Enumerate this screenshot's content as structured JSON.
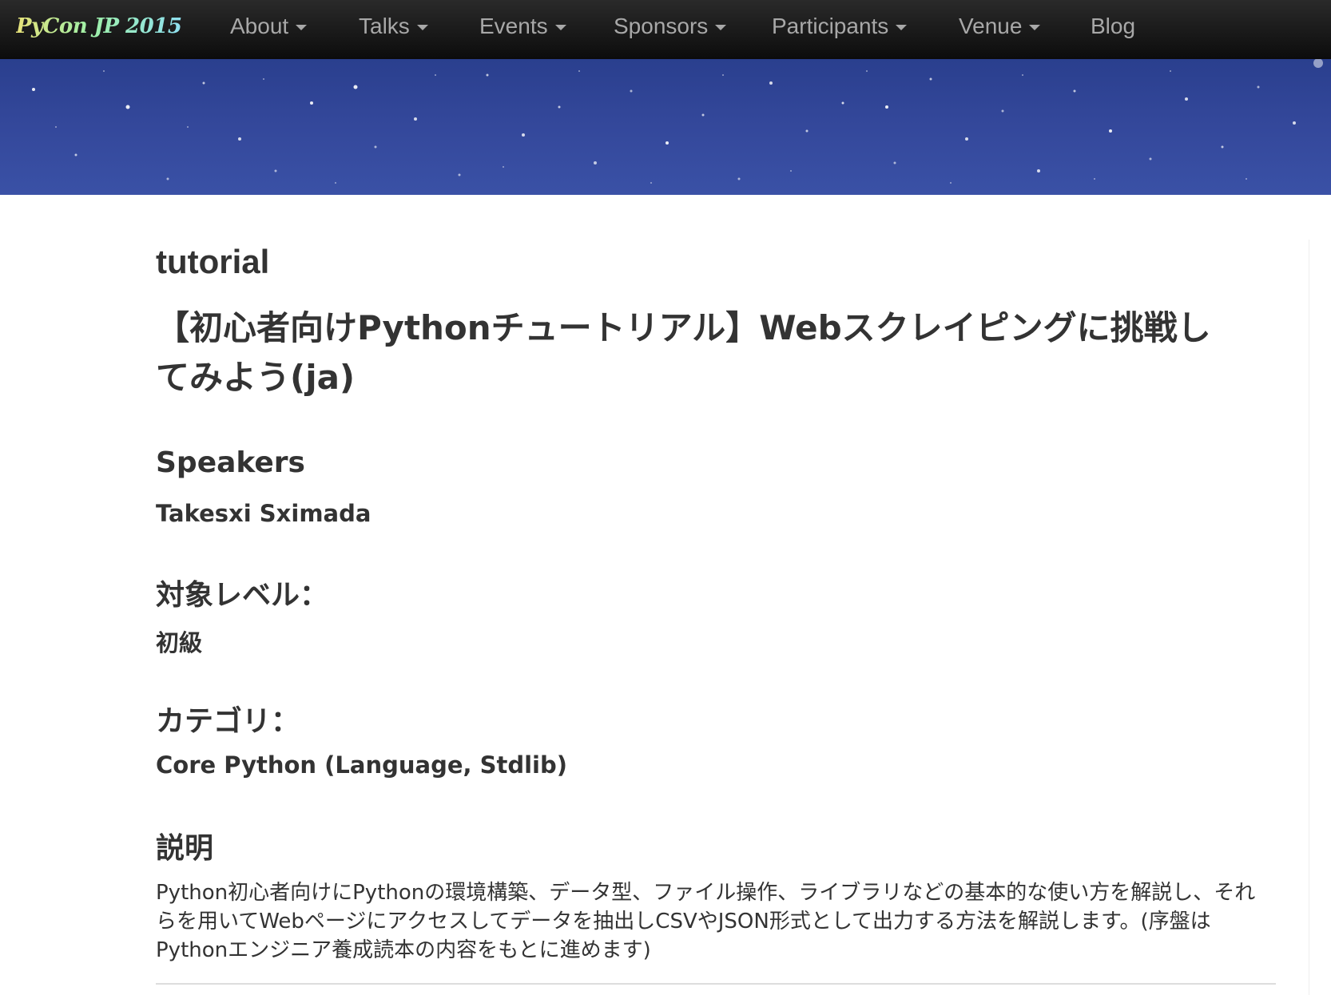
{
  "navbar": {
    "brand": "PyCon JP 2015",
    "items": [
      {
        "label": "About",
        "dropdown": true
      },
      {
        "label": "Talks",
        "dropdown": true
      },
      {
        "label": "Events",
        "dropdown": true
      },
      {
        "label": "Sponsors",
        "dropdown": true
      },
      {
        "label": "Participants",
        "dropdown": true
      },
      {
        "label": "Venue",
        "dropdown": true
      },
      {
        "label": "Blog",
        "dropdown": false
      }
    ]
  },
  "colors": {
    "navbar_bg": "#111111",
    "nav_text": "#a8a8a8",
    "banner_bg": "#34489b",
    "body_text": "#333333"
  },
  "talk": {
    "kind": "tutorial",
    "title": "【初心者向けPythonチュートリアル】Webスクレイピングに挑戦してみよう(ja)",
    "speakers_heading": "Speakers",
    "speaker": "Takesxi Sximada",
    "level_heading": "対象レベル：",
    "level": "初級",
    "category_heading": "カテゴリ：",
    "category": "Core Python (Language, Stdlib)",
    "description_heading": "説明",
    "description": "Python初心者向けにPythonの環境構築、データ型、ファイル操作、ライブラリなどの基本的な使い方を解説し、それらを用いてWebページにアクセスしてデータを抽出しCSVやJSON形式として出力する方法を解説します。(序盤はPythonエンジニア養成読本の内容をもとに進めます)"
  }
}
